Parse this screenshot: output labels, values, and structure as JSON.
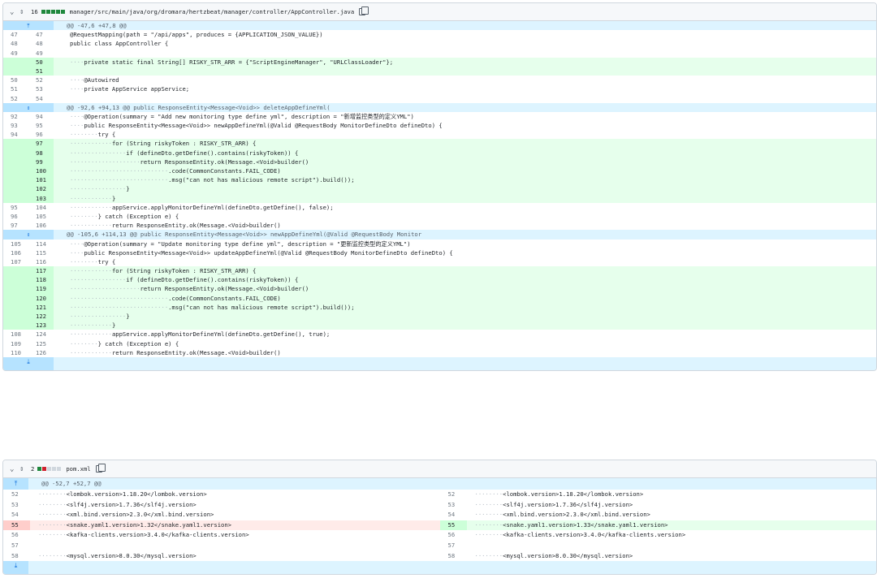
{
  "file1": {
    "changes": "16",
    "path": "manager/src/main/java/org/dromara/hertzbeat/manager/controller/AppController.java",
    "hunks": [
      {
        "header": "@@ -47,6 +47,8 @@",
        "lines": [
          {
            "t": "ctx",
            "o": "47",
            "n": "47",
            "c": "@RequestMapping(path = \"/api/apps\", produces = {APPLICATION_JSON_VALUE})"
          },
          {
            "t": "ctx",
            "o": "48",
            "n": "48",
            "c": "public class AppController {"
          },
          {
            "t": "ctx",
            "o": "49",
            "n": "49",
            "c": ""
          },
          {
            "t": "add",
            "o": "",
            "n": "50",
            "c": "····private static final String[] RISKY_STR_ARR = {\"ScriptEngineManager\", \"URLClassLoader\"};"
          },
          {
            "t": "add",
            "o": "",
            "n": "51",
            "c": ""
          },
          {
            "t": "ctx",
            "o": "50",
            "n": "52",
            "c": "····@Autowired"
          },
          {
            "t": "ctx",
            "o": "51",
            "n": "53",
            "c": "····private AppService appService;"
          },
          {
            "t": "ctx",
            "o": "52",
            "n": "54",
            "c": ""
          }
        ]
      },
      {
        "header": "@@ -92,6 +94,13 @@ public ResponseEntity<Message<Void>> deleteAppDefineYml(",
        "lines": [
          {
            "t": "ctx",
            "o": "92",
            "n": "94",
            "c": "····@Operation(summary = \"Add new monitoring type define yml\", description = \"新增监控类型的定义YML\")"
          },
          {
            "t": "ctx",
            "o": "93",
            "n": "95",
            "c": "····public ResponseEntity<Message<Void>> newAppDefineYml(@Valid @RequestBody MonitorDefineDto defineDto) {"
          },
          {
            "t": "ctx",
            "o": "94",
            "n": "96",
            "c": "········try {"
          },
          {
            "t": "add",
            "o": "",
            "n": "97",
            "c": "············for (String riskyToken : RISKY_STR_ARR) {"
          },
          {
            "t": "add",
            "o": "",
            "n": "98",
            "c": "················if (defineDto.getDefine().contains(riskyToken)) {"
          },
          {
            "t": "add",
            "o": "",
            "n": "99",
            "c": "····················return ResponseEntity.ok(Message.<Void>builder()"
          },
          {
            "t": "add",
            "o": "",
            "n": "100",
            "c": "····························.code(CommonConstants.FAIL_CODE)"
          },
          {
            "t": "add",
            "o": "",
            "n": "101",
            "c": "····························.msg(\"can not has malicious remote script\").build());"
          },
          {
            "t": "add",
            "o": "",
            "n": "102",
            "c": "················}"
          },
          {
            "t": "add",
            "o": "",
            "n": "103",
            "c": "············}"
          },
          {
            "t": "ctx",
            "o": "95",
            "n": "104",
            "c": "············appService.applyMonitorDefineYml(defineDto.getDefine(), false);"
          },
          {
            "t": "ctx",
            "o": "96",
            "n": "105",
            "c": "········} catch (Exception e) {"
          },
          {
            "t": "ctx",
            "o": "97",
            "n": "106",
            "c": "············return ResponseEntity.ok(Message.<Void>builder()"
          }
        ]
      },
      {
        "header": "@@ -105,6 +114,13 @@ public ResponseEntity<Message<Void>> newAppDefineYml(@Valid @RequestBody Monitor",
        "lines": [
          {
            "t": "ctx",
            "o": "105",
            "n": "114",
            "c": "····@Operation(summary = \"Update monitoring type define yml\", description = \"更新监控类型的定义YML\")"
          },
          {
            "t": "ctx",
            "o": "106",
            "n": "115",
            "c": "····public ResponseEntity<Message<Void>> updateAppDefineYml(@Valid @RequestBody MonitorDefineDto defineDto) {"
          },
          {
            "t": "ctx",
            "o": "107",
            "n": "116",
            "c": "········try {"
          },
          {
            "t": "add",
            "o": "",
            "n": "117",
            "c": "············for (String riskyToken : RISKY_STR_ARR) {"
          },
          {
            "t": "add",
            "o": "",
            "n": "118",
            "c": "················if (defineDto.getDefine().contains(riskyToken)) {"
          },
          {
            "t": "add",
            "o": "",
            "n": "119",
            "c": "····················return ResponseEntity.ok(Message.<Void>builder()"
          },
          {
            "t": "add",
            "o": "",
            "n": "120",
            "c": "····························.code(CommonConstants.FAIL_CODE)"
          },
          {
            "t": "add",
            "o": "",
            "n": "121",
            "c": "····························.msg(\"can not has malicious remote script\").build());"
          },
          {
            "t": "add",
            "o": "",
            "n": "122",
            "c": "················}"
          },
          {
            "t": "add",
            "o": "",
            "n": "123",
            "c": "············}"
          },
          {
            "t": "ctx",
            "o": "108",
            "n": "124",
            "c": "············appService.applyMonitorDefineYml(defineDto.getDefine(), true);"
          },
          {
            "t": "ctx",
            "o": "109",
            "n": "125",
            "c": "········} catch (Exception e) {"
          },
          {
            "t": "ctx",
            "o": "110",
            "n": "126",
            "c": "············return ResponseEntity.ok(Message.<Void>builder()"
          }
        ]
      }
    ]
  },
  "file2": {
    "changes": "2",
    "path": "pom.xml",
    "hunk_header": "@@ -52,7 +52,7 @@",
    "left": [
      {
        "t": "ctx",
        "n": "52",
        "c": "········<lombok.version>1.18.20</lombok.version>"
      },
      {
        "t": "ctx",
        "n": "53",
        "c": "········<slf4j.version>1.7.36</slf4j.version>"
      },
      {
        "t": "ctx",
        "n": "54",
        "c": "········<xml.bind.version>2.3.0</xml.bind.version>"
      },
      {
        "t": "del",
        "n": "55",
        "c": "········<snake.yaml1.version>1.32</snake.yaml1.version>"
      },
      {
        "t": "ctx",
        "n": "56",
        "c": "········<kafka-clients.version>3.4.0</kafka-clients.version>"
      },
      {
        "t": "ctx",
        "n": "57",
        "c": ""
      },
      {
        "t": "ctx",
        "n": "58",
        "c": "········<mysql.version>8.0.30</mysql.version>"
      }
    ],
    "right": [
      {
        "t": "ctx",
        "n": "52",
        "c": "········<lombok.version>1.18.20</lombok.version>"
      },
      {
        "t": "ctx",
        "n": "53",
        "c": "········<slf4j.version>1.7.36</slf4j.version>"
      },
      {
        "t": "ctx",
        "n": "54",
        "c": "········<xml.bind.version>2.3.0</xml.bind.version>"
      },
      {
        "t": "add",
        "n": "55",
        "c": "········<snake.yaml1.version>1.33</snake.yaml1.version>"
      },
      {
        "t": "ctx",
        "n": "56",
        "c": "········<kafka-clients.version>3.4.0</kafka-clients.version>"
      },
      {
        "t": "ctx",
        "n": "57",
        "c": ""
      },
      {
        "t": "ctx",
        "n": "58",
        "c": "········<mysql.version>8.0.30</mysql.version>"
      }
    ]
  }
}
